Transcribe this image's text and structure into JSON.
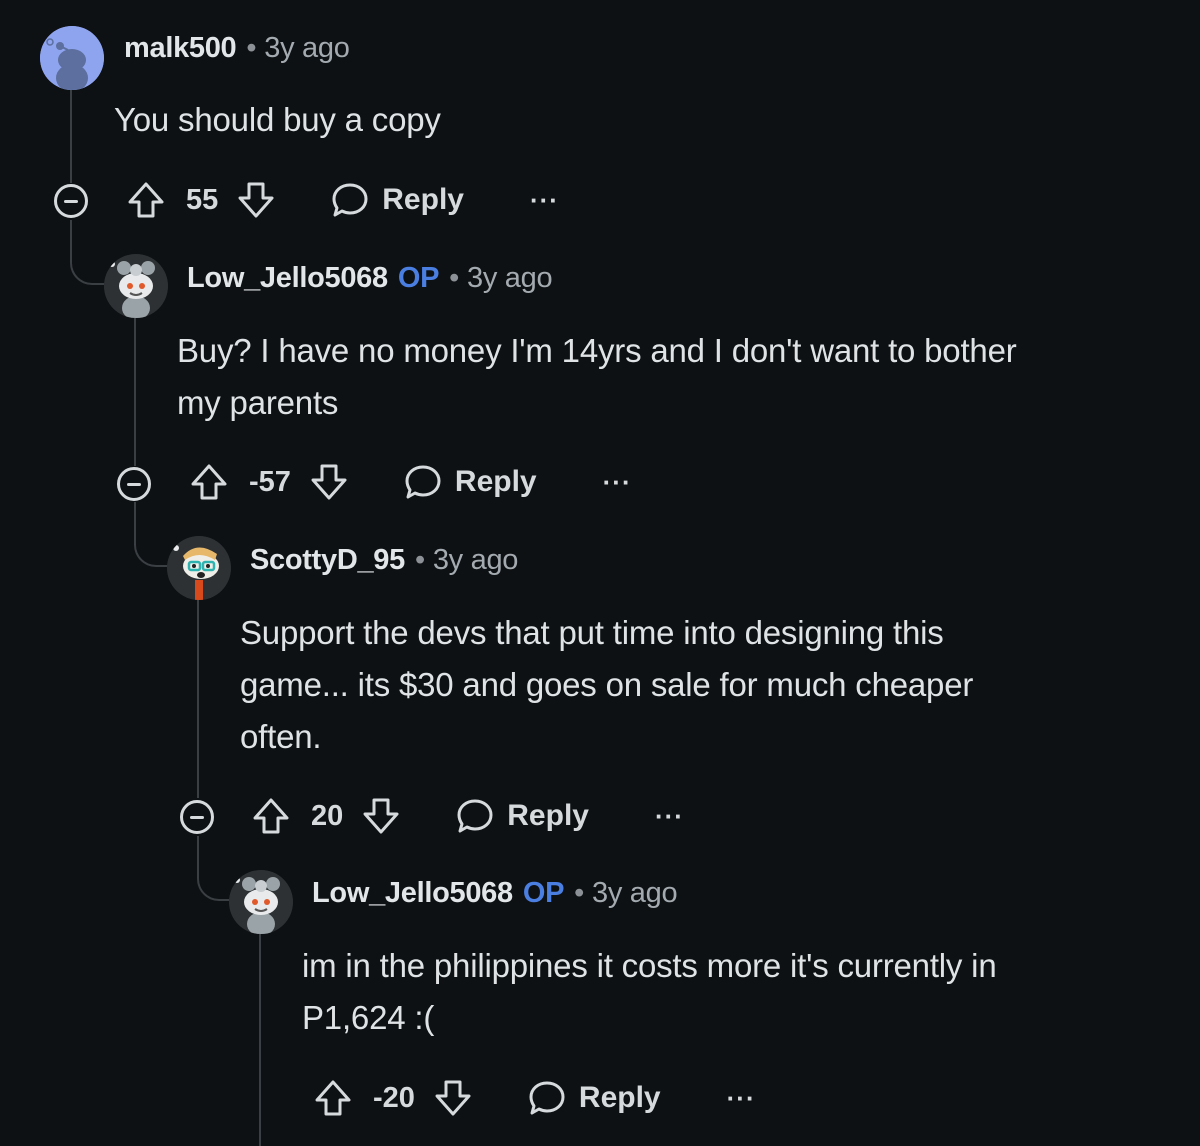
{
  "comments": [
    {
      "author": "malk500",
      "op_badge": "",
      "separator": "•",
      "time": "3y ago",
      "body_lines": [
        "You should buy a copy"
      ],
      "score": "55",
      "reply_label": "Reply",
      "more": "···"
    },
    {
      "author": "Low_Jello5068",
      "op_badge": "OP",
      "separator": "•",
      "time": "3y ago",
      "body_lines": [
        "Buy? I have no money I'm 14yrs and I don't want to bother",
        "my parents"
      ],
      "score": "-57",
      "reply_label": "Reply",
      "more": "···"
    },
    {
      "author": "ScottyD_95",
      "op_badge": "",
      "separator": "•",
      "time": "3y ago",
      "body_lines": [
        "Support the devs that put time into designing this",
        "game... its $30 and goes on sale for much cheaper",
        "often."
      ],
      "score": "20",
      "reply_label": "Reply",
      "more": "···"
    },
    {
      "author": "Low_Jello5068",
      "op_badge": "OP",
      "separator": "•",
      "time": "3y ago",
      "body_lines": [
        "im in the philippines it costs more it's currently in",
        "P1,624 :("
      ],
      "score": "-20",
      "reply_label": "Reply",
      "more": "···"
    }
  ],
  "colors": {
    "background": "#0e1113",
    "op_badge": "#4a7ee0",
    "thread_line": "#3a3f44"
  }
}
